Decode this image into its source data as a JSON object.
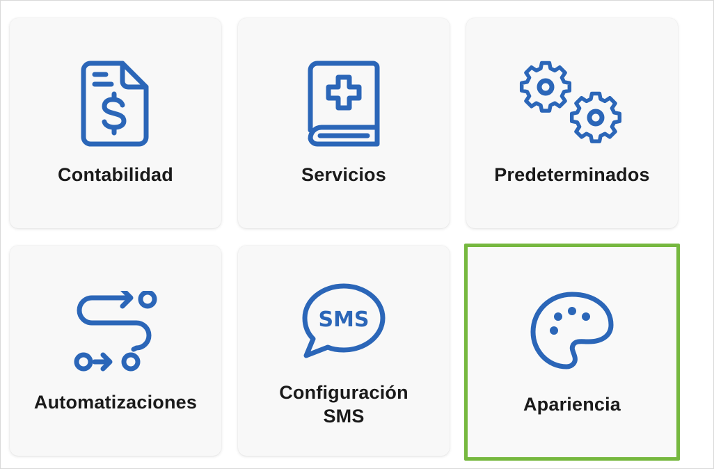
{
  "colors": {
    "icon_blue": "#2b66b8",
    "selected_border": "#76b83f",
    "tile_bg": "#f8f8f8",
    "label": "#1a1a1a"
  },
  "tiles": [
    {
      "label": "Contabilidad",
      "icon": "invoice-dollar-icon"
    },
    {
      "label": "Servicios",
      "icon": "medical-book-icon"
    },
    {
      "label": "Predeterminados",
      "icon": "gears-icon"
    },
    {
      "label": "Automatizaciones",
      "icon": "route-automation-icon"
    },
    {
      "label": "Configuración\nSMS",
      "icon": "sms-bubble-icon"
    },
    {
      "label": "Apariencia",
      "icon": "palette-icon",
      "selected": true
    }
  ]
}
